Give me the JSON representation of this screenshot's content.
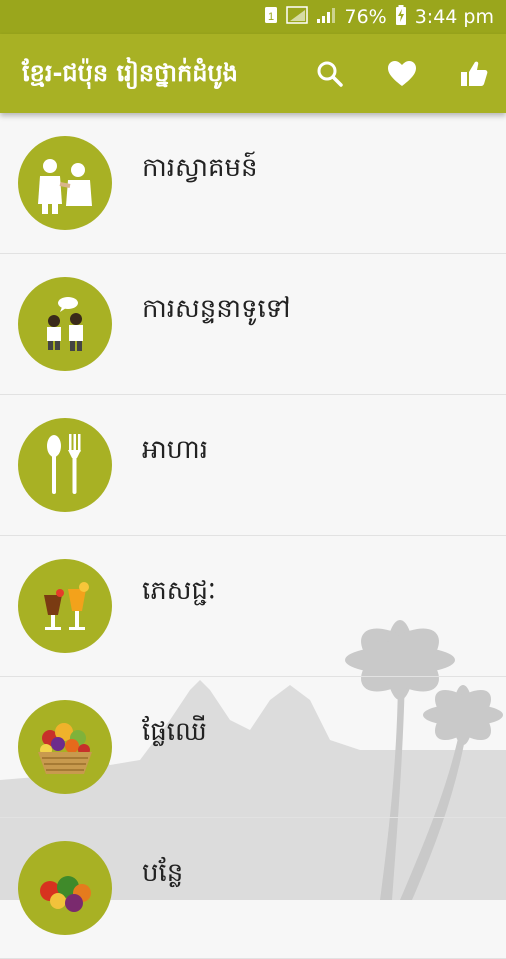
{
  "status_bar": {
    "sim": "1",
    "battery": "76%",
    "time": "3:44 pm"
  },
  "app_bar": {
    "title": "ខ្មែរ-ជប៉ុន រៀនថ្នាក់ដំបូង",
    "actions": [
      "search-icon",
      "heart-icon",
      "thumbs-up-icon"
    ]
  },
  "categories": [
    {
      "label": "ការស្វាគមន៍",
      "icon": "greeting-people-icon"
    },
    {
      "label": "ការសន្ទនាទូទៅ",
      "icon": "conversation-icon"
    },
    {
      "label": "អាហារ",
      "icon": "spoon-fork-icon"
    },
    {
      "label": "ភេសជ្ជៈ",
      "icon": "drinks-icon"
    },
    {
      "label": "ផ្លែឈើ",
      "icon": "fruit-basket-icon"
    },
    {
      "label": "បន្លែ",
      "icon": "vegetables-icon"
    }
  ],
  "colors": {
    "accent": "#a8b124",
    "status_bar": "#9aa61c",
    "background": "#f7f7f7"
  }
}
